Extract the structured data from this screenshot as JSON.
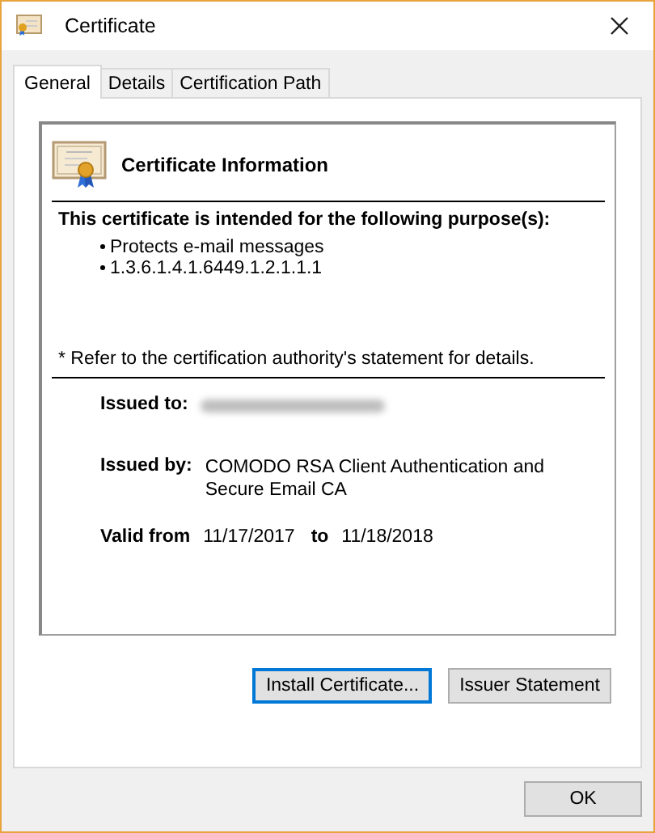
{
  "window": {
    "title": "Certificate"
  },
  "tabs": [
    {
      "label": "General",
      "selected": true
    },
    {
      "label": "Details",
      "selected": false
    },
    {
      "label": "Certification Path",
      "selected": false
    }
  ],
  "info": {
    "heading": "Certificate Information",
    "purpose_intro": "This certificate is intended for the following purpose(s):",
    "purposes": [
      "Protects e-mail messages",
      "1.3.6.1.4.1.6449.1.2.1.1.1"
    ],
    "note": "* Refer to the certification authority's statement for details.",
    "issued_to": {
      "label": "Issued to:",
      "redacted": true
    },
    "issued_by": {
      "label": "Issued by:",
      "value": "COMODO RSA Client Authentication and Secure Email CA"
    },
    "validity": {
      "label": "Valid from",
      "from": "11/17/2017",
      "to_label": "to",
      "to": "11/18/2018"
    }
  },
  "panel_buttons": [
    {
      "label": "Install Certificate...",
      "focused": true
    },
    {
      "label": "Issuer Statement",
      "focused": false
    }
  ],
  "footer_buttons": [
    {
      "label": "OK",
      "focused": false
    }
  ]
}
